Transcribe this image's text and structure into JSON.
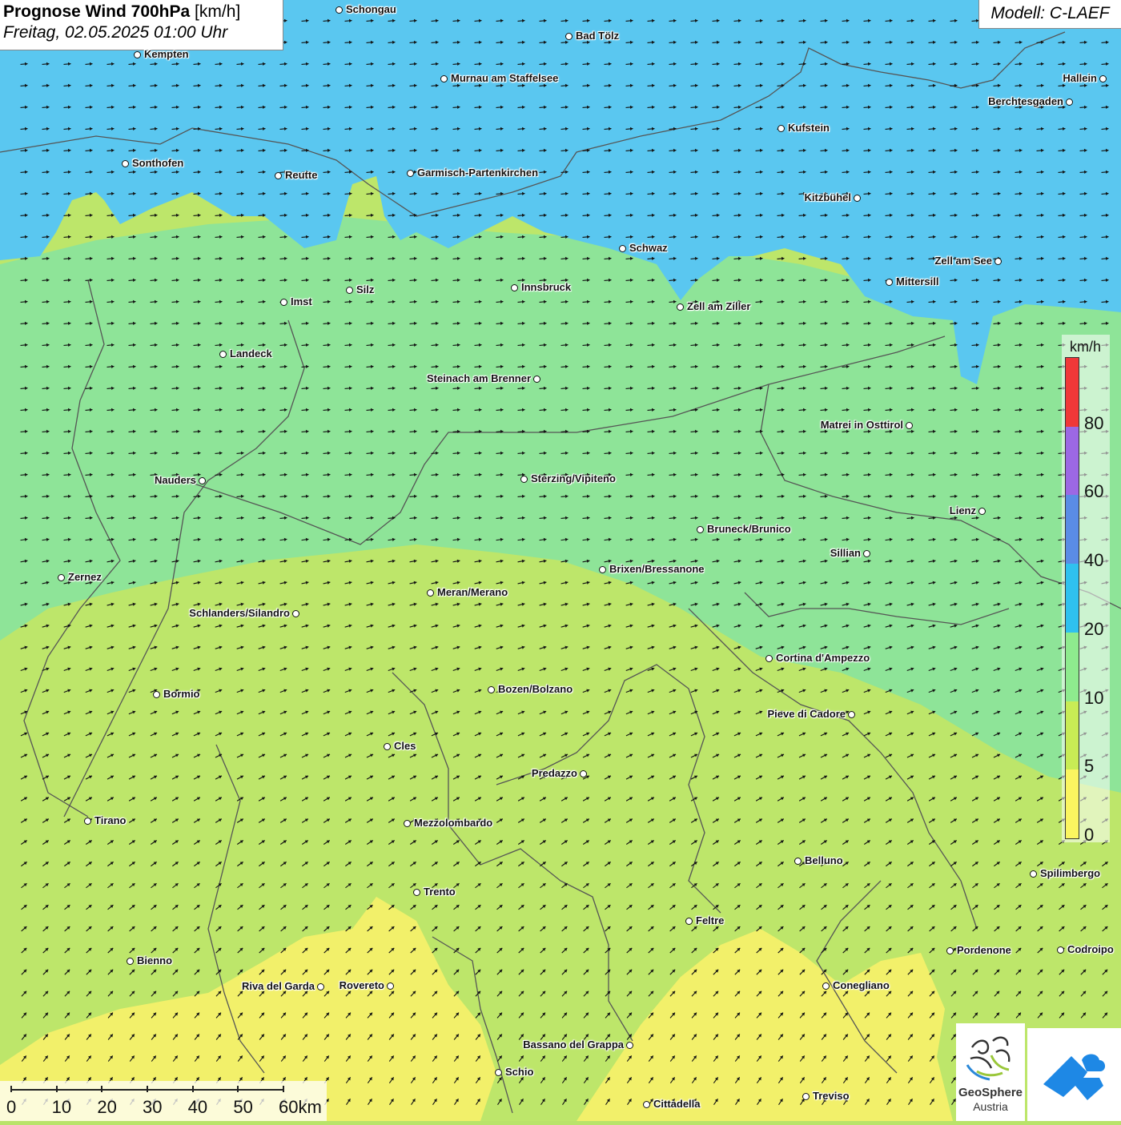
{
  "header": {
    "title_bold": "Prognose Wind 700hPa",
    "title_unit": "[km/h]",
    "subtitle": "Freitag, 02.05.2025 01:00 Uhr"
  },
  "model": {
    "label": "Modell: C-LAEF"
  },
  "legend": {
    "unit": "km/h",
    "ticks": [
      "0",
      "5",
      "10",
      "20",
      "40",
      "60",
      "80"
    ],
    "colors": [
      "#fbf560",
      "#c8ec55",
      "#8eeb8e",
      "#2fc1ef",
      "#5a8ce6",
      "#9c68e4",
      "#f03838"
    ]
  },
  "scale_bar": {
    "labels": [
      "0",
      "10",
      "20",
      "30",
      "40",
      "50",
      "60km"
    ]
  },
  "colors": {
    "zone_strong": "#5ac7f0",
    "zone_mid": "#8ee498",
    "zone_low": "#bde66a",
    "zone_calm": "#f2f06a",
    "border": "#555555"
  },
  "cities": [
    {
      "name": "Schongau"
    },
    {
      "name": "Bad Tölz"
    },
    {
      "name": "Kempten"
    },
    {
      "name": "Murnau am Staffelsee"
    },
    {
      "name": "Hallein"
    },
    {
      "name": "Berchtesgaden"
    },
    {
      "name": "Kufstein"
    },
    {
      "name": "Sonthofen"
    },
    {
      "name": "Reutte"
    },
    {
      "name": "Garmisch-Partenkirchen"
    },
    {
      "name": "Kitzbühel"
    },
    {
      "name": "Schwaz"
    },
    {
      "name": "Zell am See"
    },
    {
      "name": "Mittersill"
    },
    {
      "name": "Silz"
    },
    {
      "name": "Innsbruck"
    },
    {
      "name": "Imst"
    },
    {
      "name": "Zell am Ziller"
    },
    {
      "name": "Landeck"
    },
    {
      "name": "Steinach am Brenner"
    },
    {
      "name": "Matrei in Osttirol"
    },
    {
      "name": "Nauders"
    },
    {
      "name": "Sterzing/Vipiteno"
    },
    {
      "name": "Lienz"
    },
    {
      "name": "Bruneck/Brunico"
    },
    {
      "name": "Sillian"
    },
    {
      "name": "Zernez"
    },
    {
      "name": "Brixen/Bressanone"
    },
    {
      "name": "Meran/Merano"
    },
    {
      "name": "Schlanders/Silandro"
    },
    {
      "name": "Cortina d'Ampezzo"
    },
    {
      "name": "Bormio"
    },
    {
      "name": "Bozen/Bolzano"
    },
    {
      "name": "Pieve di Cadore"
    },
    {
      "name": "Cles"
    },
    {
      "name": "Predazzo"
    },
    {
      "name": "Tirano"
    },
    {
      "name": "Mezzolombardo"
    },
    {
      "name": "Belluno"
    },
    {
      "name": "Spilimbergo"
    },
    {
      "name": "Trento"
    },
    {
      "name": "Feltre"
    },
    {
      "name": "Pordenone"
    },
    {
      "name": "Codroipo"
    },
    {
      "name": "Bienno"
    },
    {
      "name": "Riva del Garda"
    },
    {
      "name": "Rovereto"
    },
    {
      "name": "Conegliano"
    },
    {
      "name": "Bassano del Grappa"
    },
    {
      "name": "Schio"
    },
    {
      "name": "Cittadella"
    },
    {
      "name": "Treviso"
    }
  ],
  "logos": {
    "geosphere_line1": "GeoSphere",
    "geosphere_line2": "Austria"
  }
}
